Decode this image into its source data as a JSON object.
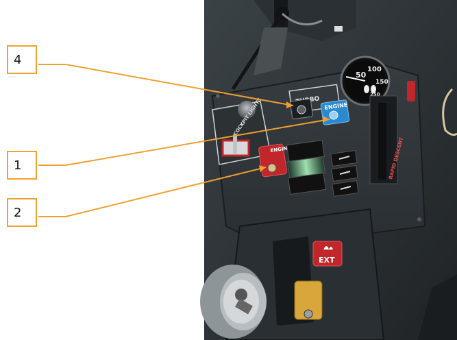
{
  "callouts": [
    {
      "number": "4"
    },
    {
      "number": "1"
    },
    {
      "number": "2"
    }
  ],
  "panel": {
    "turbo_label": "TURBO",
    "engine_label": "ENGINE",
    "cockpit_lights_label": "COCKPIT LIGHTS",
    "engine_stop_label": "ENGINE STOP",
    "ext_label": "EXT",
    "gauge_values": [
      "50",
      "100",
      "150",
      "250"
    ],
    "lever_label": "RAPID DESCENT"
  },
  "colors": {
    "callout_line": "#f0a030",
    "panel_dark": "#2b3034",
    "engine_button": "#2a8ad0",
    "stop_button": "#c0262a",
    "ext_button": "#c0262a"
  }
}
